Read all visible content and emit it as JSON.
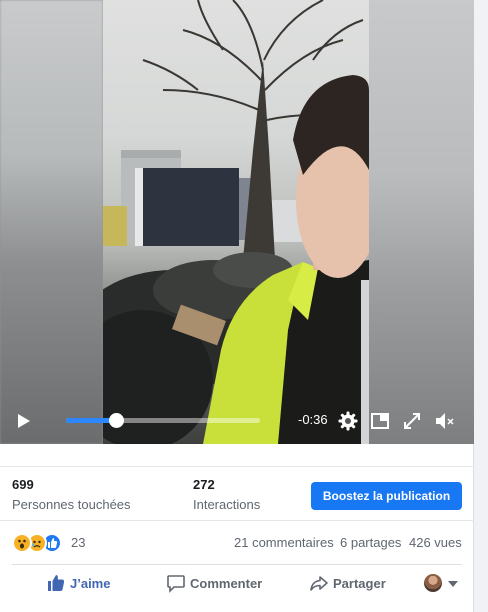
{
  "video": {
    "time_remaining": "-0:36",
    "progress_fraction": 0.26
  },
  "icons": {
    "play": "play-icon",
    "settings": "gear-icon",
    "pip": "picture-in-picture-icon",
    "fullscreen": "expand-icon",
    "mute": "speaker-muted-icon",
    "like": "thumbs-up-icon",
    "comment": "speech-bubble-icon",
    "share": "share-arrow-icon"
  },
  "stats": {
    "reach_value": "699",
    "reach_label": "Personnes touchées",
    "engagement_value": "272",
    "engagement_label": "Interactions",
    "boost_label": "Boostez la publication"
  },
  "reactions": {
    "count": "23",
    "comments": "21 commentaires",
    "shares": "6 partages",
    "views": "426 vues"
  },
  "actions": {
    "like": "J’aime",
    "comment": "Commenter",
    "share": "Partager"
  },
  "colors": {
    "accent": "#1877f2",
    "like_blue": "#4267b2",
    "seek_blue": "#2d88ff"
  }
}
